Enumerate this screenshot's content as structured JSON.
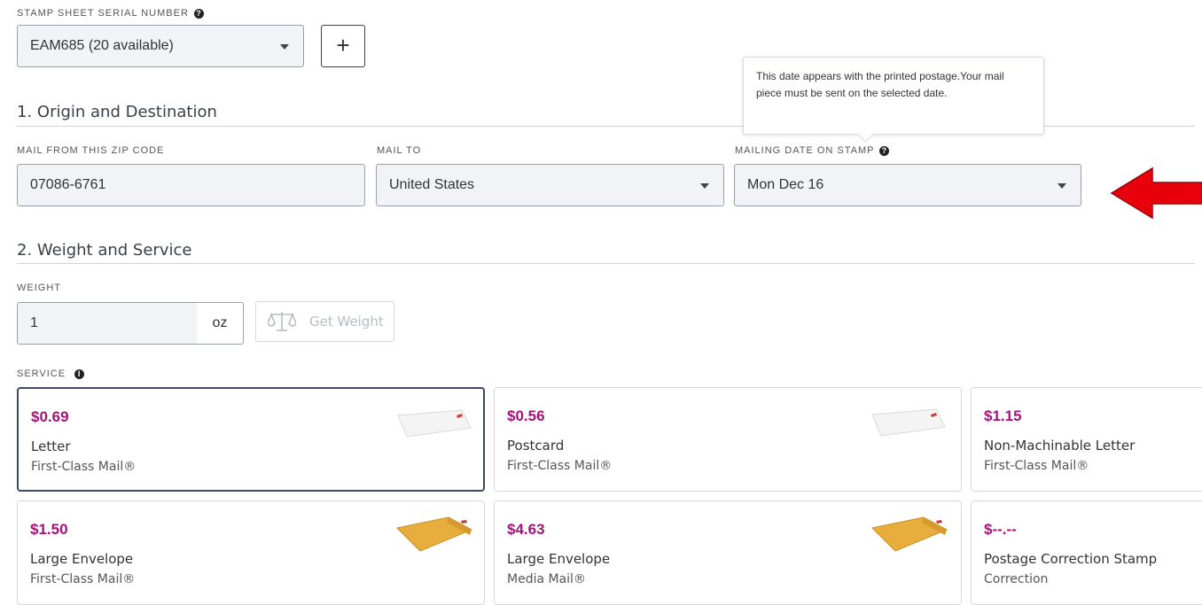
{
  "stamp_sheet": {
    "label": "STAMP SHEET SERIAL NUMBER",
    "selected": "EAM685 (20 available)",
    "add_label": "+"
  },
  "section1": {
    "title": "1. Origin and Destination",
    "from_label": "MAIL FROM THIS ZIP CODE",
    "from_value": "07086-6761",
    "to_label": "MAIL TO",
    "to_value": "United States",
    "date_label": "MAILING DATE ON STAMP",
    "date_value": "Mon Dec 16",
    "tooltip": "This date appears with the printed postage.Your mail piece must be sent on the selected date."
  },
  "section2": {
    "title": "2. Weight and Service",
    "weight_label": "WEIGHT",
    "weight_value": "1",
    "weight_unit": "oz",
    "get_weight_label": "Get Weight",
    "service_label": "SERVICE"
  },
  "services": [
    {
      "price": "$0.69",
      "name": "Letter",
      "class": "First-Class Mail®",
      "icon": "letter-envelope-icon",
      "selected": true
    },
    {
      "price": "$0.56",
      "name": "Postcard",
      "class": "First-Class Mail®",
      "icon": "postcard-icon",
      "selected": false
    },
    {
      "price": "$1.15",
      "name": "Non-Machinable Letter",
      "class": "First-Class Mail®",
      "icon": "",
      "selected": false
    },
    {
      "price": "$1.50",
      "name": "Large Envelope",
      "class": "First-Class Mail®",
      "icon": "large-envelope-icon",
      "selected": false
    },
    {
      "price": "$4.63",
      "name": "Large Envelope",
      "class": "Media Mail®",
      "icon": "large-envelope-icon",
      "selected": false
    },
    {
      "price": "$--.--",
      "name": "Postage Correction Stamp",
      "class": "Correction",
      "icon": "",
      "selected": false
    }
  ],
  "colors": {
    "price": "#a3147a",
    "selected_border": "#3b4a6b",
    "annotation_arrow": "#e8000b",
    "input_bg": "#f1f3f7"
  }
}
